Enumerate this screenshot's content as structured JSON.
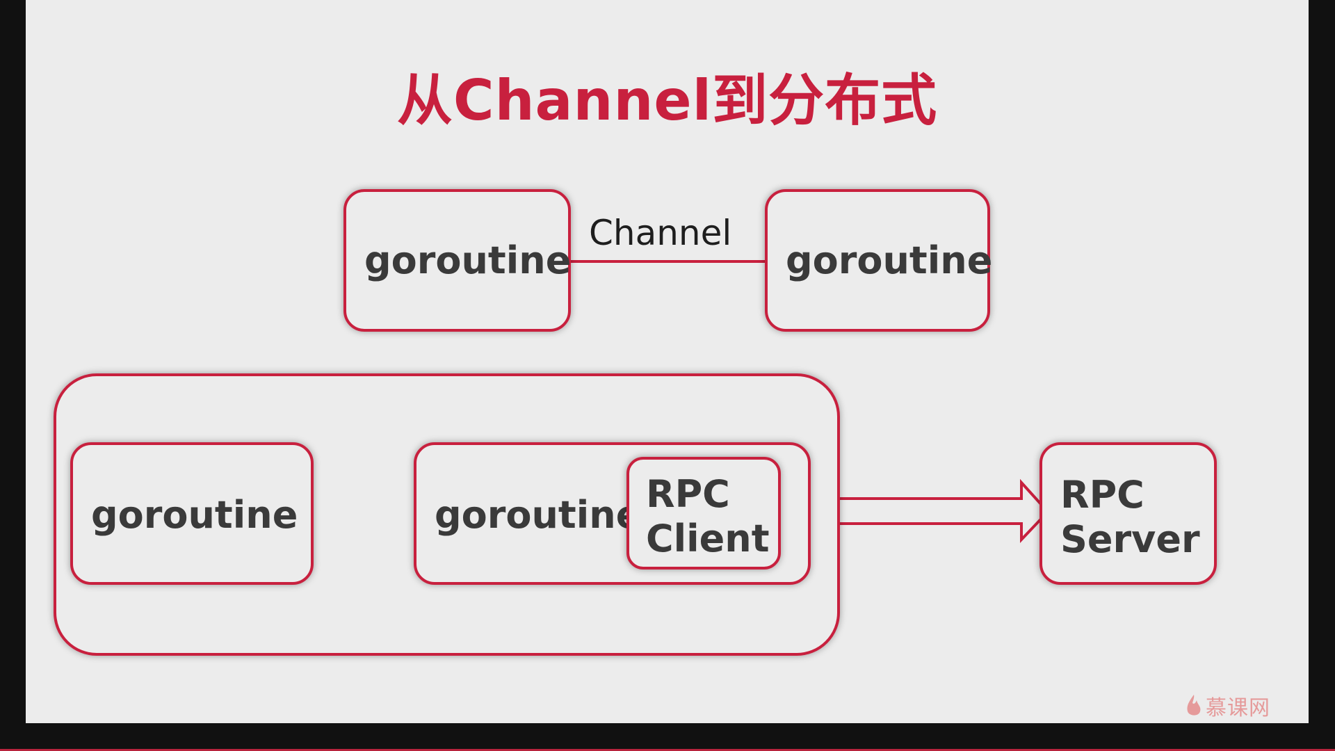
{
  "title": "从Channel到分布式",
  "nodes": {
    "top_left": "goroutine",
    "top_right": "goroutine",
    "bottom_left": "goroutine",
    "bottom_middle": "goroutine",
    "rpc_client_line1": "RPC",
    "rpc_client_line2": "Client",
    "rpc_server_line1": "RPC",
    "rpc_server_line2": "Server"
  },
  "edges": {
    "channel_label": "Channel"
  },
  "watermark": "慕课网",
  "colors": {
    "accent": "#c8203e",
    "slide_background": "#ececec",
    "frame": "#111111",
    "node_text": "#3a3a3a"
  }
}
